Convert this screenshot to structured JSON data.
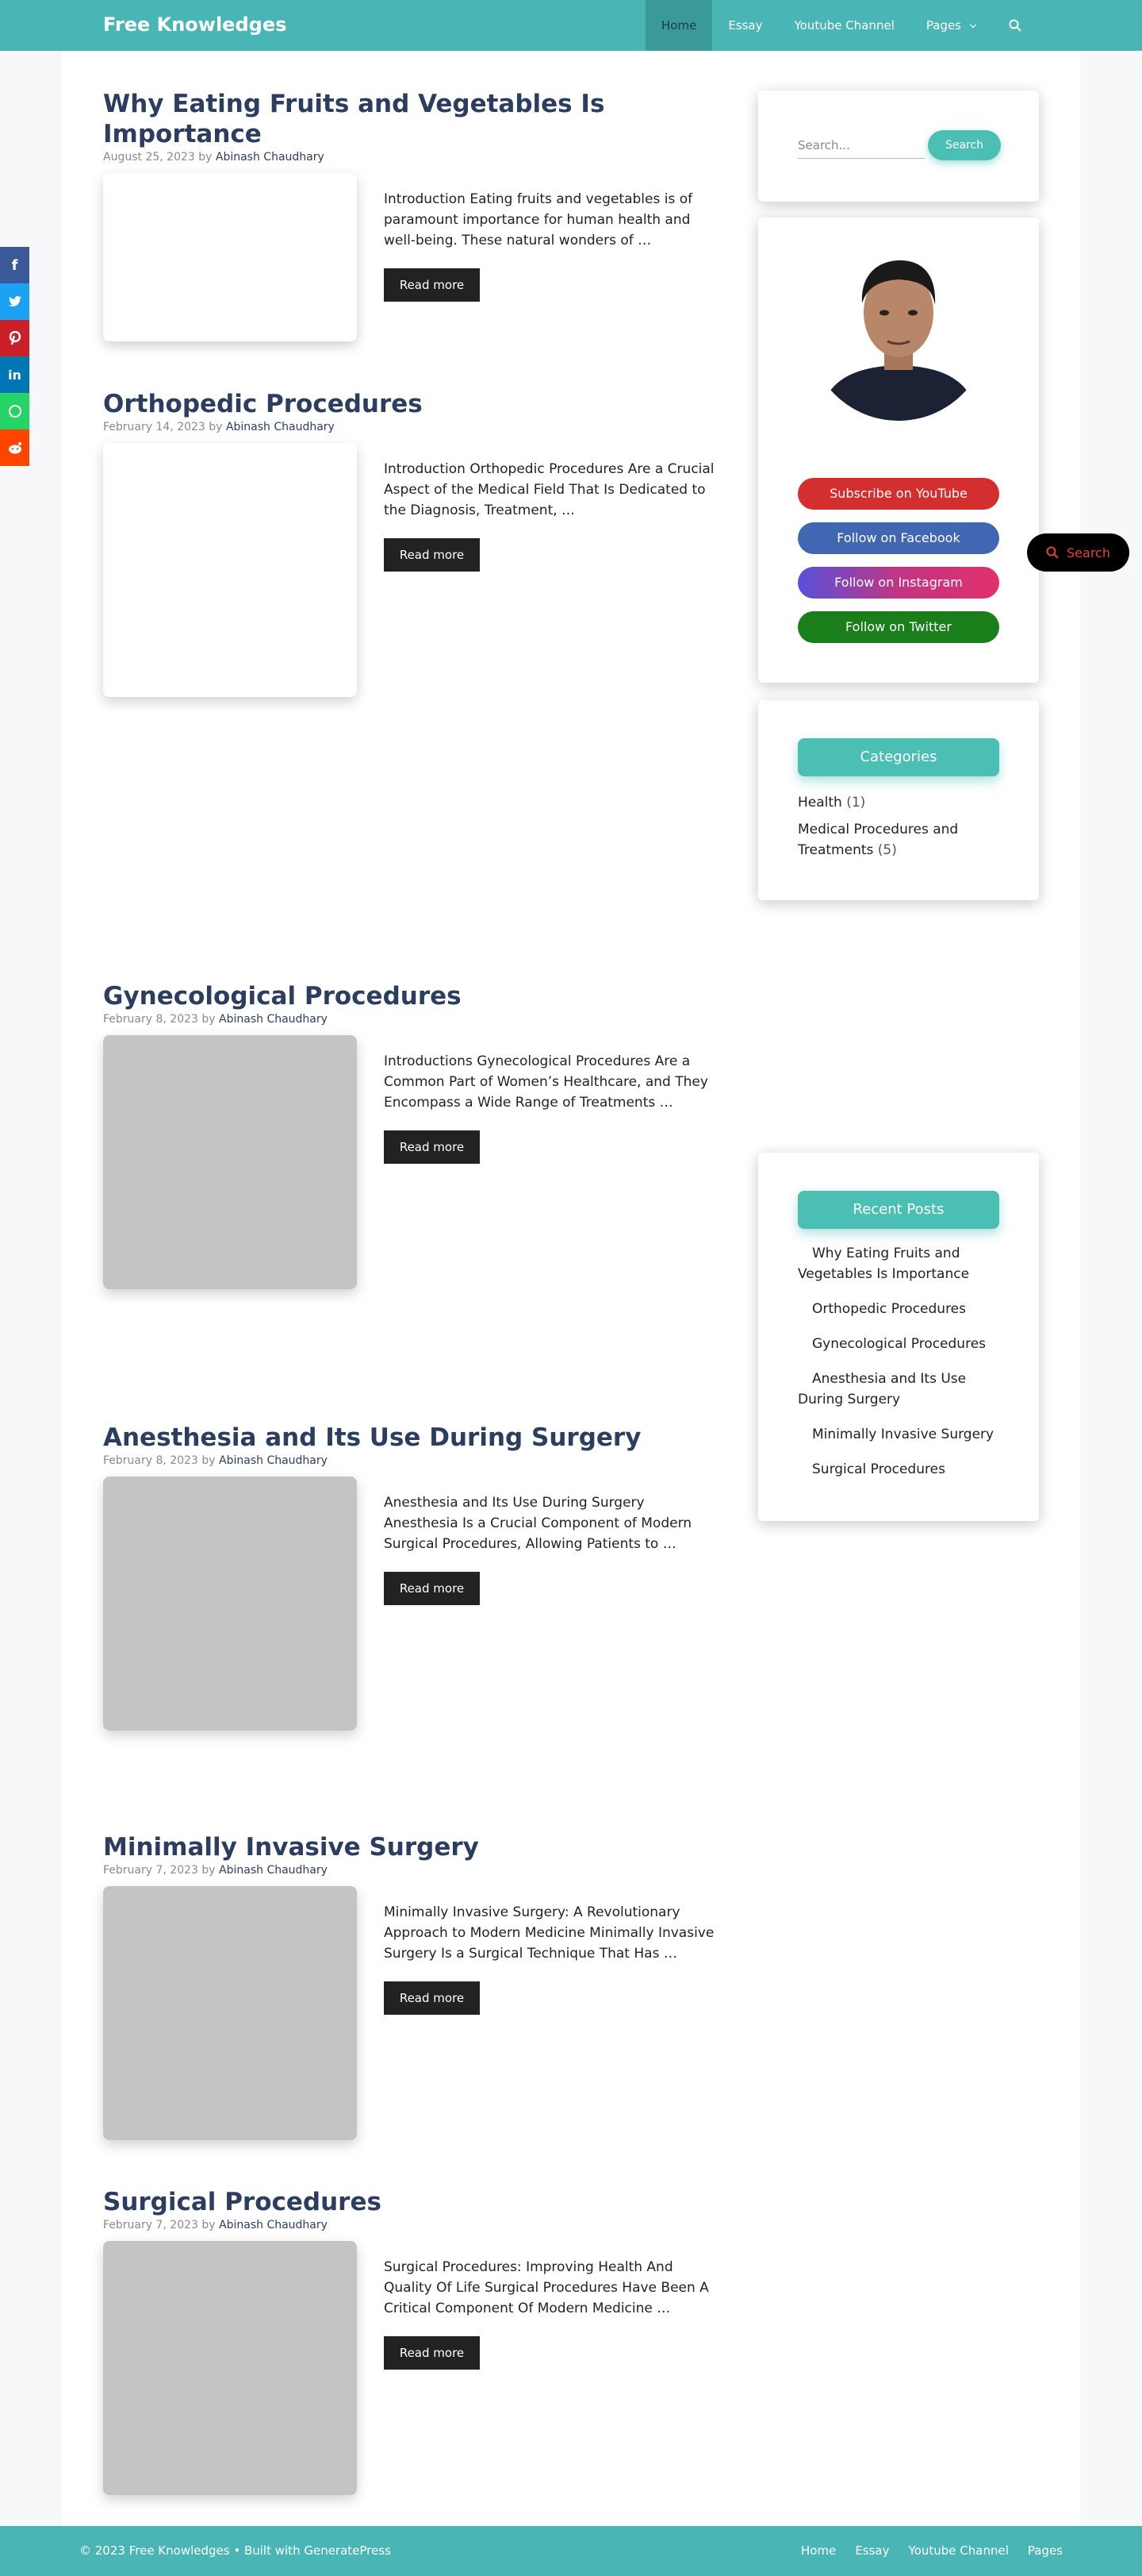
{
  "header": {
    "brand": "Free Knowledges",
    "nav": [
      {
        "label": "Home"
      },
      {
        "label": "Essay"
      },
      {
        "label": "Youtube Channel"
      },
      {
        "label": "Pages"
      }
    ],
    "search_icon": "search-icon"
  },
  "posts": [
    {
      "title": "Why Eating Fruits and Vegetables Is Importance",
      "date": "August 25, 2023",
      "by": "by",
      "author": "Abinash Chaudhary",
      "excerpt": "Introduction Eating fruits and vegetables is of paramount importance for human health and well-being. These natural wonders of …",
      "read_more": "Read more"
    },
    {
      "title": "Orthopedic Procedures",
      "date": "February 14, 2023",
      "by": "by",
      "author": "Abinash Chaudhary",
      "excerpt": "Introduction Orthopedic Procedures Are a Crucial Aspect of the Medical Field That Is Dedicated to the Diagnosis, Treatment, …",
      "read_more": "Read more"
    },
    {
      "title": "Gynecological Procedures",
      "date": "February 8, 2023",
      "by": "by",
      "author": "Abinash Chaudhary",
      "excerpt": "Introductions Gynecological Procedures Are a Common Part of Women’s Healthcare, and They Encompass a Wide Range of Treatments …",
      "read_more": "Read more"
    },
    {
      "title": "Anesthesia and Its Use During Surgery",
      "date": "February 8, 2023",
      "by": "by",
      "author": "Abinash Chaudhary",
      "excerpt": "Anesthesia and Its Use During Surgery Anesthesia Is a Crucial Component of Modern Surgical Procedures, Allowing Patients to …",
      "read_more": "Read more"
    },
    {
      "title": "Minimally Invasive Surgery",
      "date": "February 7, 2023",
      "by": "by",
      "author": "Abinash Chaudhary",
      "excerpt": "Minimally Invasive Surgery: A Revolutionary Approach to Modern Medicine Minimally Invasive Surgery Is a Surgical Technique That Has …",
      "read_more": "Read more"
    },
    {
      "title": "Surgical Procedures",
      "date": "February 7, 2023",
      "by": "by",
      "author": "Abinash Chaudhary",
      "excerpt": "Surgical Procedures: Improving Health And Quality Of Life Surgical Procedures Have Been A Critical Component Of Modern Medicine …",
      "read_more": "Read more"
    }
  ],
  "share": [
    {
      "icon": "facebook-icon",
      "glyph": "f",
      "color": "#3b5998"
    },
    {
      "icon": "twitter-icon",
      "glyph": "t",
      "color": "#1da1f2"
    },
    {
      "icon": "pinterest-icon",
      "glyph": "p",
      "color": "#cb2027"
    },
    {
      "icon": "linkedin-icon",
      "glyph": "in",
      "color": "#0077b5"
    },
    {
      "icon": "whatsapp-icon",
      "glyph": "w",
      "color": "#25d366"
    },
    {
      "icon": "reddit-icon",
      "glyph": "r",
      "color": "#ff4500"
    }
  ],
  "sidebar": {
    "search": {
      "placeholder": "Search...",
      "button": "Search"
    },
    "profile": {
      "buttons": [
        {
          "label": "Subscribe on YouTube",
          "color": "#d32f2f"
        },
        {
          "label": "Follow on Facebook",
          "color": "#4267b2"
        },
        {
          "label": "Follow on Instagram",
          "color": "#8a3ab9"
        },
        {
          "label": "Follow on Twitter",
          "color": "#1a7f1a"
        }
      ]
    },
    "categories": {
      "heading": "Categories",
      "items": [
        {
          "label": "Health",
          "count": "(1)"
        },
        {
          "label": "Medical Procedures and Treatments",
          "count": "(5)"
        }
      ]
    },
    "recent": {
      "heading": "Recent Posts",
      "items": [
        "Why Eating Fruits and Vegetables Is Importance",
        "Orthopedic Procedures",
        "Gynecological Procedures",
        "Anesthesia and Its Use During Surgery",
        "Minimally Invasive Surgery",
        "Surgical Procedures"
      ]
    }
  },
  "float_search": {
    "label": "Search"
  },
  "footer": {
    "copyright": "© 2023 Free Knowledges • Built with GeneratePress",
    "links": [
      "Home",
      "Essay",
      "Youtube Channel",
      "Pages"
    ]
  },
  "colors": {
    "header": "#4ab5b5",
    "accent": "#4bbfb3",
    "title": "#2c3e5f"
  }
}
